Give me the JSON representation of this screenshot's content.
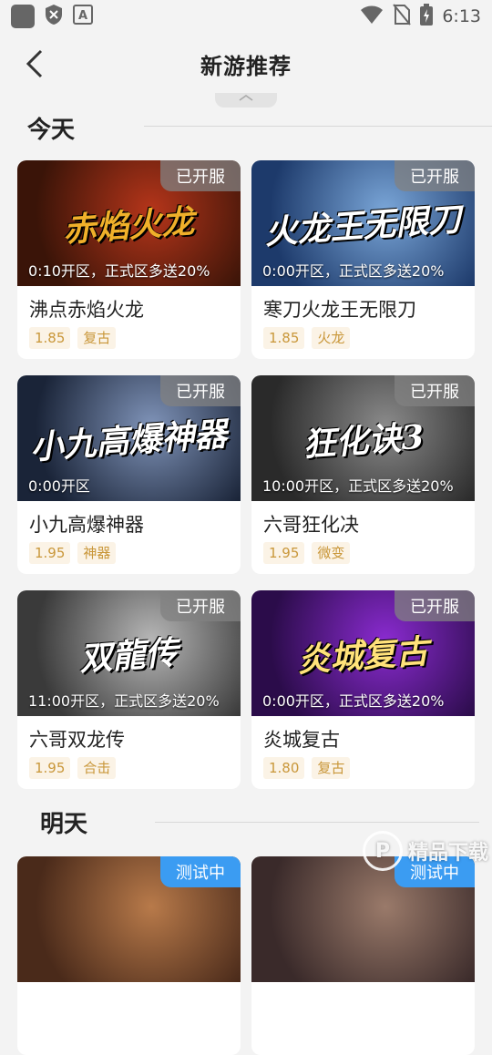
{
  "status_bar": {
    "time": "6:13",
    "icons": [
      "app-square-icon",
      "shield-icon",
      "font-icon",
      "wifi-icon",
      "no-sim-icon",
      "battery-charging-icon"
    ]
  },
  "header": {
    "title": "新游推荐",
    "back_icon": "chevron-left-icon"
  },
  "sections": [
    {
      "title": "今天",
      "cards": [
        {
          "name": "沸点赤焰火龙",
          "badge": "已开服",
          "open_info": "0:10开区，正式区多送20%",
          "discount": "1.85",
          "tag": "复古",
          "art_title": "赤焰火龙",
          "art_color": "#f0b02a",
          "bg1": "#3a1408",
          "bg2": "#b5351a"
        },
        {
          "name": "寒刀火龙王无限刀",
          "badge": "已开服",
          "open_info": "0:00开区，正式区多送20%",
          "discount": "1.85",
          "tag": "火龙",
          "art_title": "火龙王无限刀",
          "art_color": "#ffffff",
          "bg1": "#1d3a6b",
          "bg2": "#7aa6d8"
        },
        {
          "name": "小九高爆神器",
          "badge": "已开服",
          "open_info": "0:00开区",
          "discount": "1.95",
          "tag": "神器",
          "art_title": "小九高爆神器",
          "art_color": "#ffffff",
          "bg1": "#1a2438",
          "bg2": "#7f93b8"
        },
        {
          "name": "六哥狂化决",
          "badge": "已开服",
          "open_info": "10:00开区，正式区多送20%",
          "discount": "1.95",
          "tag": "微变",
          "art_title": "狂化诀3",
          "art_color": "#ffffff",
          "bg1": "#2a2a2a",
          "bg2": "#8a8a8a"
        },
        {
          "name": "六哥双龙传",
          "badge": "已开服",
          "open_info": "11:00开区，正式区多送20%",
          "discount": "1.95",
          "tag": "合击",
          "art_title": "双龍传",
          "art_color": "#ffffff",
          "bg1": "#3a3a3a",
          "bg2": "#b7b7b7"
        },
        {
          "name": "炎城复古",
          "badge": "已开服",
          "open_info": "0:00开区，正式区多送20%",
          "discount": "1.80",
          "tag": "复古",
          "art_title": "炎城复古",
          "art_color": "#ffe27a",
          "bg1": "#2b0c4a",
          "bg2": "#8a2bd0"
        }
      ]
    },
    {
      "title": "明天",
      "cards": [
        {
          "badge": "测试中",
          "bg1": "#4a2a1a",
          "bg2": "#b87a4a"
        },
        {
          "badge": "测试中",
          "bg1": "#3a2a2a",
          "bg2": "#9a7a6a"
        }
      ]
    }
  ],
  "watermark": {
    "text": "精品下载",
    "mark": "P"
  },
  "colors": {
    "badge_open": "rgba(130,130,130,0.75)",
    "badge_test": "#3b9cf2",
    "tag_text": "#c9973a",
    "tag_bg": "#fbf3e6"
  }
}
